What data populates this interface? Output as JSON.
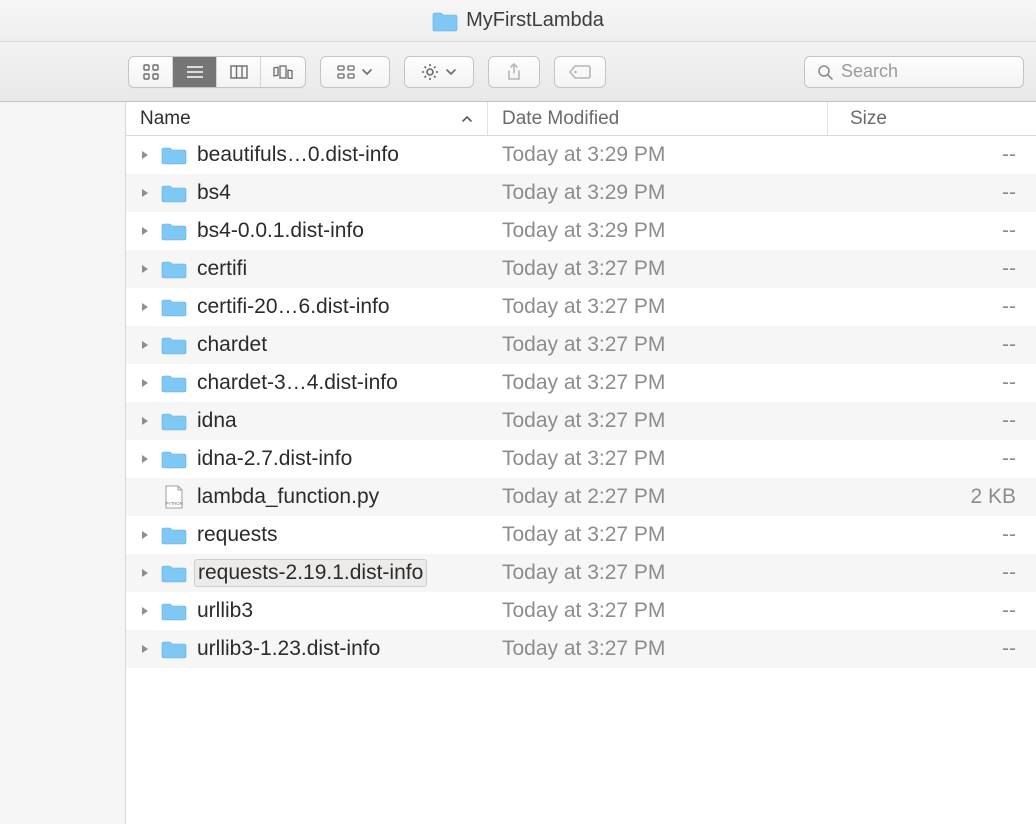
{
  "window": {
    "title": "MyFirstLambda"
  },
  "toolbar": {
    "search_placeholder": "Search"
  },
  "columns": {
    "name": "Name",
    "date": "Date Modified",
    "size": "Size"
  },
  "files": [
    {
      "name": "beautifuls…0.dist-info",
      "date": "Today at 3:29 PM",
      "size": "--",
      "type": "folder",
      "expandable": true
    },
    {
      "name": "bs4",
      "date": "Today at 3:29 PM",
      "size": "--",
      "type": "folder",
      "expandable": true
    },
    {
      "name": "bs4-0.0.1.dist-info",
      "date": "Today at 3:29 PM",
      "size": "--",
      "type": "folder",
      "expandable": true
    },
    {
      "name": "certifi",
      "date": "Today at 3:27 PM",
      "size": "--",
      "type": "folder",
      "expandable": true
    },
    {
      "name": "certifi-20…6.dist-info",
      "date": "Today at 3:27 PM",
      "size": "--",
      "type": "folder",
      "expandable": true
    },
    {
      "name": "chardet",
      "date": "Today at 3:27 PM",
      "size": "--",
      "type": "folder",
      "expandable": true
    },
    {
      "name": "chardet-3…4.dist-info",
      "date": "Today at 3:27 PM",
      "size": "--",
      "type": "folder",
      "expandable": true
    },
    {
      "name": "idna",
      "date": "Today at 3:27 PM",
      "size": "--",
      "type": "folder",
      "expandable": true
    },
    {
      "name": "idna-2.7.dist-info",
      "date": "Today at 3:27 PM",
      "size": "--",
      "type": "folder",
      "expandable": true
    },
    {
      "name": "lambda_function.py",
      "date": "Today at 2:27 PM",
      "size": "2 KB",
      "type": "pyfile",
      "expandable": false
    },
    {
      "name": "requests",
      "date": "Today at 3:27 PM",
      "size": "--",
      "type": "folder",
      "expandable": true
    },
    {
      "name": "requests-2.19.1.dist-info",
      "date": "Today at 3:27 PM",
      "size": "--",
      "type": "folder",
      "expandable": true,
      "tagged": true
    },
    {
      "name": "urllib3",
      "date": "Today at 3:27 PM",
      "size": "--",
      "type": "folder",
      "expandable": true
    },
    {
      "name": "urllib3-1.23.dist-info",
      "date": "Today at 3:27 PM",
      "size": "--",
      "type": "folder",
      "expandable": true
    }
  ]
}
